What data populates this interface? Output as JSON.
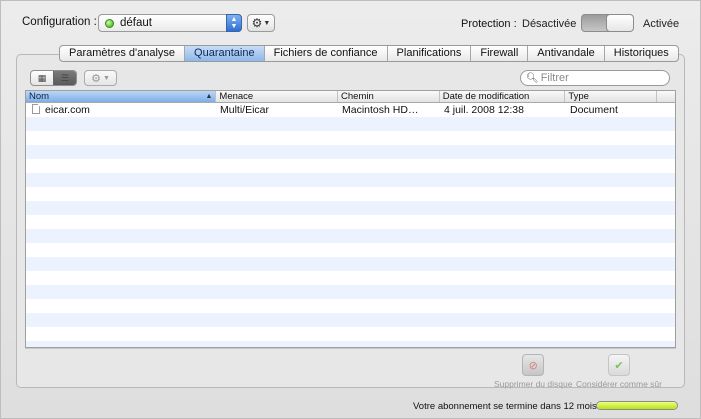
{
  "config": {
    "label": "Configuration :",
    "selected": "défaut"
  },
  "protection": {
    "label": "Protection :",
    "off_label": "Désactivée",
    "on_label": "Activée",
    "state": "off"
  },
  "tabs": [
    {
      "label": "Paramètres d'analyse",
      "active": false
    },
    {
      "label": "Quarantaine",
      "active": true
    },
    {
      "label": "Fichiers de confiance",
      "active": false
    },
    {
      "label": "Planifications",
      "active": false
    },
    {
      "label": "Firewall",
      "active": false
    },
    {
      "label": "Antivandale",
      "active": false
    },
    {
      "label": "Historiques",
      "active": false
    }
  ],
  "filter": {
    "placeholder": "Filtrer",
    "value": ""
  },
  "table": {
    "columns": [
      "Nom",
      "Menace",
      "Chemin",
      "Date de modification",
      "Type"
    ],
    "sorted_column": "Nom",
    "rows": [
      {
        "name": "eicar.com",
        "threat": "Multi/Eicar",
        "path": "Macintosh HD…",
        "date": "4 juil. 2008 12:38",
        "type": "Document"
      }
    ]
  },
  "actions": {
    "delete_label": "Supprimer du disque",
    "trust_label": "Considérer comme sûr"
  },
  "subscription": {
    "text": "Votre abonnement se termine dans 12 mois",
    "progress": 1.0
  },
  "colors": {
    "active_tab": "#8fb7ea",
    "status_green": "#35a81a",
    "subscription_bar": "#b9e21b"
  }
}
